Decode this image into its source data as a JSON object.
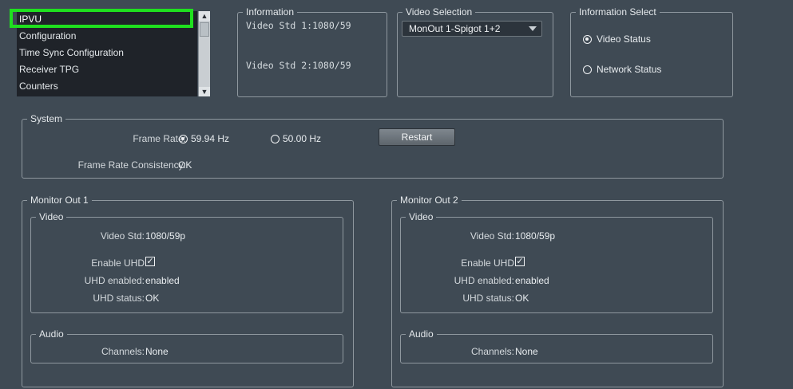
{
  "nav": {
    "items": [
      "IPVU",
      "Configuration",
      "Time Sync Configuration",
      "Receiver TPG",
      "Counters"
    ],
    "selected": "IPVU"
  },
  "information": {
    "title": "Information",
    "line1": "Video Std 1:1080/59",
    "line2": "Video Std 2:1080/59"
  },
  "video_selection": {
    "title": "Video Selection",
    "value": "MonOut 1-Spigot 1+2"
  },
  "information_select": {
    "title": "Information Select",
    "options": [
      "Video Status",
      "Network Status"
    ],
    "selected": "Video Status"
  },
  "system": {
    "title": "System",
    "frame_rate_label": "Frame Rate:",
    "frame_rate_options": [
      "59.94 Hz",
      "50.00 Hz"
    ],
    "frame_rate_selected": "59.94 Hz",
    "restart_label": "Restart",
    "consistency_label": "Frame Rate Consistency:",
    "consistency_value": "OK"
  },
  "monitors": [
    {
      "title": "Monitor Out 1",
      "video_title": "Video",
      "video_std_label": "Video Std:",
      "video_std_value": "1080/59p",
      "enable_uhd_label": "Enable UHD",
      "enable_uhd_checked": true,
      "uhd_enabled_label": "UHD enabled:",
      "uhd_enabled_value": "enabled",
      "uhd_status_label": "UHD status:",
      "uhd_status_value": "OK",
      "audio_title": "Audio",
      "channels_label": "Channels:",
      "channels_value": "None"
    },
    {
      "title": "Monitor Out 2",
      "video_title": "Video",
      "video_std_label": "Video Std:",
      "video_std_value": "1080/59p",
      "enable_uhd_label": "Enable UHD",
      "enable_uhd_checked": true,
      "uhd_enabled_label": "UHD enabled:",
      "uhd_enabled_value": "enabled",
      "uhd_status_label": "UHD status:",
      "uhd_status_value": "OK",
      "audio_title": "Audio",
      "channels_label": "Channels:",
      "channels_value": "None"
    }
  ],
  "colors": {
    "background": "#3f4a54",
    "highlight": "#1fe01f",
    "list_background": "#1f2329"
  }
}
